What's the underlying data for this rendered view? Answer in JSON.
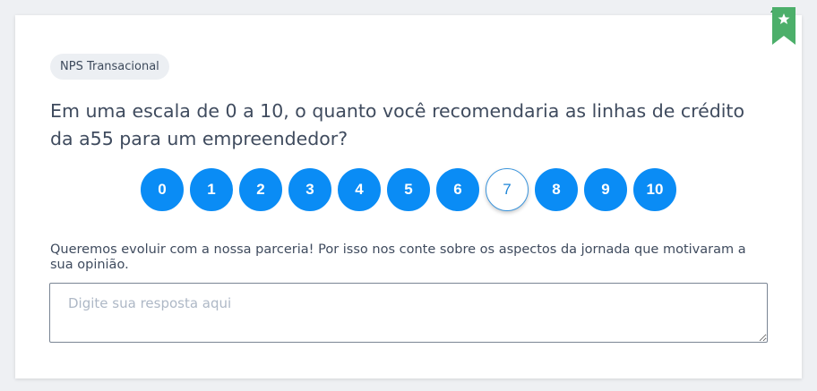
{
  "survey": {
    "badge": "NPS Transacional",
    "question": "Em uma escala de 0 a 10, o quanto você recomendaria as linhas de crédito da a55 para um empreendedor?",
    "scores": [
      "0",
      "1",
      "2",
      "3",
      "4",
      "5",
      "6",
      "7",
      "8",
      "9",
      "10"
    ],
    "selected_score": "7",
    "follow_up_prompt": "Queremos evoluir com a nossa parceria! Por isso nos conte sobre os aspectos da jornada que motivaram a sua opinião.",
    "answer_placeholder": "Digite sua resposta aqui",
    "answer_value": ""
  },
  "bookmark": {
    "icon": "star-icon",
    "color": "#4caf6a",
    "dark_color": "#2e7d4a"
  },
  "colors": {
    "accent": "#0a8cf5",
    "text": "#3f4b5e"
  }
}
